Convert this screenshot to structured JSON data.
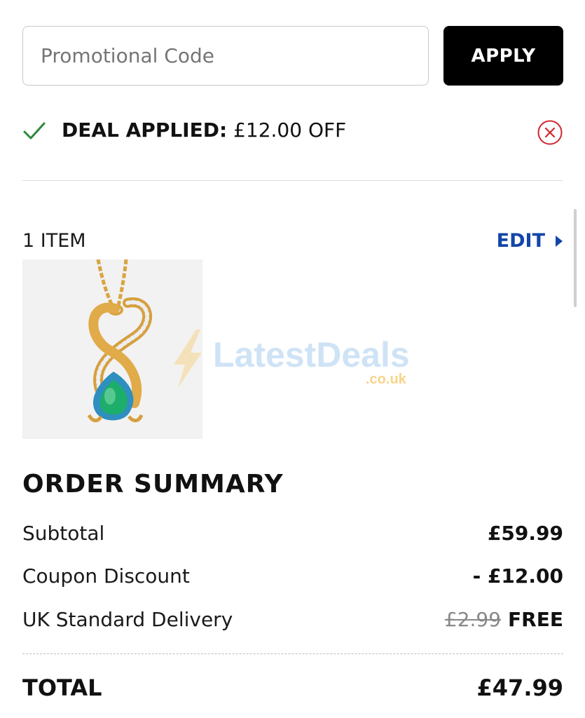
{
  "promo": {
    "placeholder": "Promotional Code",
    "value": "",
    "apply_label": "APPLY"
  },
  "deal": {
    "label": "DEAL APPLIED:",
    "amount": "£12.00 OFF",
    "check_icon": "check-icon",
    "remove_icon": "close-circle-icon",
    "check_color": "#2a8a3a",
    "remove_color": "#d0262e"
  },
  "items": {
    "count_label": "1 ITEM",
    "edit_label": "EDIT",
    "edit_color": "#1346a8",
    "product_image_description": ""
  },
  "watermark": {
    "brand": "LatestDeals",
    "suffix": ".co.uk"
  },
  "summary": {
    "title": "ORDER SUMMARY",
    "lines": [
      {
        "label": "Subtotal",
        "value": "£59.99",
        "old_value": ""
      },
      {
        "label": "Coupon Discount",
        "value": "- £12.00",
        "old_value": ""
      },
      {
        "label": "UK Standard Delivery",
        "value": "FREE",
        "old_value": "£2.99"
      }
    ],
    "total_label": "TOTAL",
    "total_value": "£47.99"
  }
}
